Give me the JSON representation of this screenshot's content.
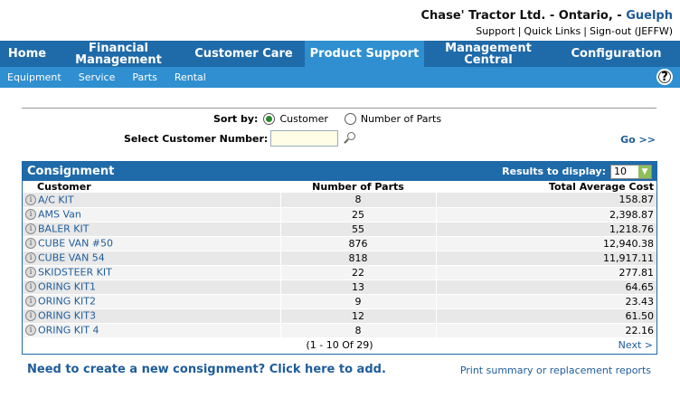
{
  "header": {
    "company": "Chase' Tractor Ltd. - Ontario, - ",
    "location": "Guelph",
    "links": [
      "Support",
      "Quick Links",
      "Sign-out (JEFFW)"
    ]
  },
  "nav": {
    "tabs": [
      {
        "label": "Home"
      },
      {
        "label": "Financial Management"
      },
      {
        "label": "Customer Care"
      },
      {
        "label": "Product Support"
      },
      {
        "label": "Management Central"
      },
      {
        "label": "Configuration"
      }
    ],
    "active": "Product Support",
    "subtabs": [
      "Equipment",
      "Service",
      "Parts",
      "Rental"
    ],
    "help": "?"
  },
  "filters": {
    "sort_label": "Sort by:",
    "sort_options": [
      "Customer",
      "Number of Parts"
    ],
    "selected_sort": "Customer",
    "customer_label": "Select Customer Number:",
    "customer_value": "",
    "go_label": "Go >>"
  },
  "panel": {
    "title": "Consignment",
    "results_label": "Results to display:",
    "results_value": "10",
    "columns": [
      "Customer",
      "Number of Parts",
      "Total Average Cost"
    ],
    "rows": [
      {
        "customer": "A/C KIT",
        "parts": "8",
        "cost": "158.87"
      },
      {
        "customer": "AMS Van",
        "parts": "25",
        "cost": "2,398.87"
      },
      {
        "customer": "BALER KIT",
        "parts": "55",
        "cost": "1,218.76"
      },
      {
        "customer": "CUBE VAN #50",
        "parts": "876",
        "cost": "12,940.38"
      },
      {
        "customer": "CUBE VAN 54",
        "parts": "818",
        "cost": "11,917.11"
      },
      {
        "customer": "SKIDSTEER KIT",
        "parts": "22",
        "cost": "277.81"
      },
      {
        "customer": "ORING KIT1",
        "parts": "13",
        "cost": "64.65"
      },
      {
        "customer": "ORING KIT2",
        "parts": "9",
        "cost": "23.43"
      },
      {
        "customer": "ORING KIT3",
        "parts": "12",
        "cost": "61.50"
      },
      {
        "customer": "ORING KIT 4",
        "parts": "8",
        "cost": "22.16"
      }
    ],
    "pager": "(1 - 10 Of 29)",
    "next": "Next >"
  },
  "footer": {
    "new_consignment": "Need to create a new consignment? Click here to add.",
    "print_reports": "Print summary or replacement reports"
  },
  "colors": {
    "nav_bg": "#1f6aa8",
    "nav_active": "#2f8fd0",
    "link": "#1f5c99"
  }
}
